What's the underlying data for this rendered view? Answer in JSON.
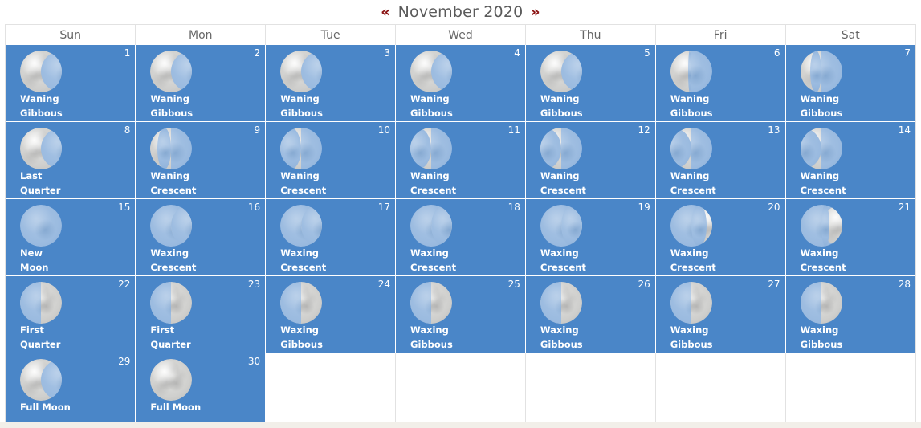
{
  "header": {
    "prev_label": "«",
    "next_label": "»",
    "month_label": "November 2020"
  },
  "weekdays": [
    "Sun",
    "Mon",
    "Tue",
    "Wed",
    "Thu",
    "Fri",
    "Sat"
  ],
  "colors": {
    "cell_blue": "#4a86c8",
    "chevron_red": "#8c1515",
    "title_gray": "#5a5a5a",
    "border_gray": "#e2e2e2",
    "text_white": "#ffffff",
    "footer_beige": "#f2efe9"
  },
  "calendar": {
    "weeks": [
      [
        {
          "day": "1",
          "phase_lines": [
            "Waning",
            "Gibbous"
          ],
          "phase": "waning-gibbous",
          "illumination": 88
        },
        {
          "day": "2",
          "phase_lines": [
            "Waning",
            "Gibbous"
          ],
          "phase": "waning-gibbous",
          "illumination": 81
        },
        {
          "day": "3",
          "phase_lines": [
            "Waning",
            "Gibbous"
          ],
          "phase": "waning-gibbous",
          "illumination": 73
        },
        {
          "day": "4",
          "phase_lines": [
            "Waning",
            "Gibbous"
          ],
          "phase": "waning-gibbous",
          "illumination": 64
        },
        {
          "day": "5",
          "phase_lines": [
            "Waning",
            "Gibbous"
          ],
          "phase": "waning-gibbous",
          "illumination": 55
        },
        {
          "day": "6",
          "phase_lines": [
            "Waning",
            "Gibbous"
          ],
          "phase": "waning-gibbous",
          "illumination": 46
        },
        {
          "day": "7",
          "phase_lines": [
            "Waning",
            "Gibbous"
          ],
          "phase": "waning-gibbous",
          "illumination": 37
        }
      ],
      [
        {
          "day": "8",
          "phase_lines": [
            "Last",
            "Quarter"
          ],
          "phase": "last-quarter",
          "illumination": 50
        },
        {
          "day": "9",
          "phase_lines": [
            "Waning",
            "Crescent"
          ],
          "phase": "waning-crescent",
          "illumination": 33
        },
        {
          "day": "10",
          "phase_lines": [
            "Waning",
            "Crescent"
          ],
          "phase": "waning-crescent",
          "illumination": 25
        },
        {
          "day": "11",
          "phase_lines": [
            "Waning",
            "Crescent"
          ],
          "phase": "waning-crescent",
          "illumination": 17
        },
        {
          "day": "12",
          "phase_lines": [
            "Waning",
            "Crescent"
          ],
          "phase": "waning-crescent",
          "illumination": 10
        },
        {
          "day": "13",
          "phase_lines": [
            "Waning",
            "Crescent"
          ],
          "phase": "waning-crescent",
          "illumination": 5
        },
        {
          "day": "14",
          "phase_lines": [
            "Waning",
            "Crescent"
          ],
          "phase": "waning-crescent",
          "illumination": 2
        }
      ],
      [
        {
          "day": "15",
          "phase_lines": [
            "New",
            "Moon"
          ],
          "phase": "new-moon",
          "illumination": 0
        },
        {
          "day": "16",
          "phase_lines": [
            "Waxing",
            "Crescent"
          ],
          "phase": "waxing-crescent",
          "illumination": 3
        },
        {
          "day": "17",
          "phase_lines": [
            "Waxing",
            "Crescent"
          ],
          "phase": "waxing-crescent",
          "illumination": 8
        },
        {
          "day": "18",
          "phase_lines": [
            "Waxing",
            "Crescent"
          ],
          "phase": "waxing-crescent",
          "illumination": 14
        },
        {
          "day": "19",
          "phase_lines": [
            "Waxing",
            "Crescent"
          ],
          "phase": "waxing-crescent",
          "illumination": 22
        },
        {
          "day": "20",
          "phase_lines": [
            "Waxing",
            "Crescent"
          ],
          "phase": "waxing-crescent",
          "illumination": 31
        },
        {
          "day": "21",
          "phase_lines": [
            "Waxing",
            "Crescent"
          ],
          "phase": "waxing-crescent",
          "illumination": 40
        }
      ],
      [
        {
          "day": "22",
          "phase_lines": [
            "First",
            "Quarter"
          ],
          "phase": "first-quarter",
          "illumination": 50
        },
        {
          "day": "23",
          "phase_lines": [
            "First",
            "Quarter"
          ],
          "phase": "first-quarter",
          "illumination": 58
        },
        {
          "day": "24",
          "phase_lines": [
            "Waxing",
            "Gibbous"
          ],
          "phase": "waxing-gibbous",
          "illumination": 67
        },
        {
          "day": "25",
          "phase_lines": [
            "Waxing",
            "Gibbous"
          ],
          "phase": "waxing-gibbous",
          "illumination": 76
        },
        {
          "day": "26",
          "phase_lines": [
            "Waxing",
            "Gibbous"
          ],
          "phase": "waxing-gibbous",
          "illumination": 84
        },
        {
          "day": "27",
          "phase_lines": [
            "Waxing",
            "Gibbous"
          ],
          "phase": "waxing-gibbous",
          "illumination": 91
        },
        {
          "day": "28",
          "phase_lines": [
            "Waxing",
            "Gibbous"
          ],
          "phase": "waxing-gibbous",
          "illumination": 96
        }
      ],
      [
        {
          "day": "29",
          "phase_lines": [
            "Full Moon"
          ],
          "phase": "full-moon",
          "illumination": 99
        },
        {
          "day": "30",
          "phase_lines": [
            "Full Moon"
          ],
          "phase": "full-moon",
          "illumination": 100
        },
        {
          "day": "",
          "phase_lines": [],
          "phase": "",
          "illumination": null
        },
        {
          "day": "",
          "phase_lines": [],
          "phase": "",
          "illumination": null
        },
        {
          "day": "",
          "phase_lines": [],
          "phase": "",
          "illumination": null
        },
        {
          "day": "",
          "phase_lines": [],
          "phase": "",
          "illumination": null
        },
        {
          "day": "",
          "phase_lines": [],
          "phase": "",
          "illumination": null
        }
      ]
    ]
  }
}
